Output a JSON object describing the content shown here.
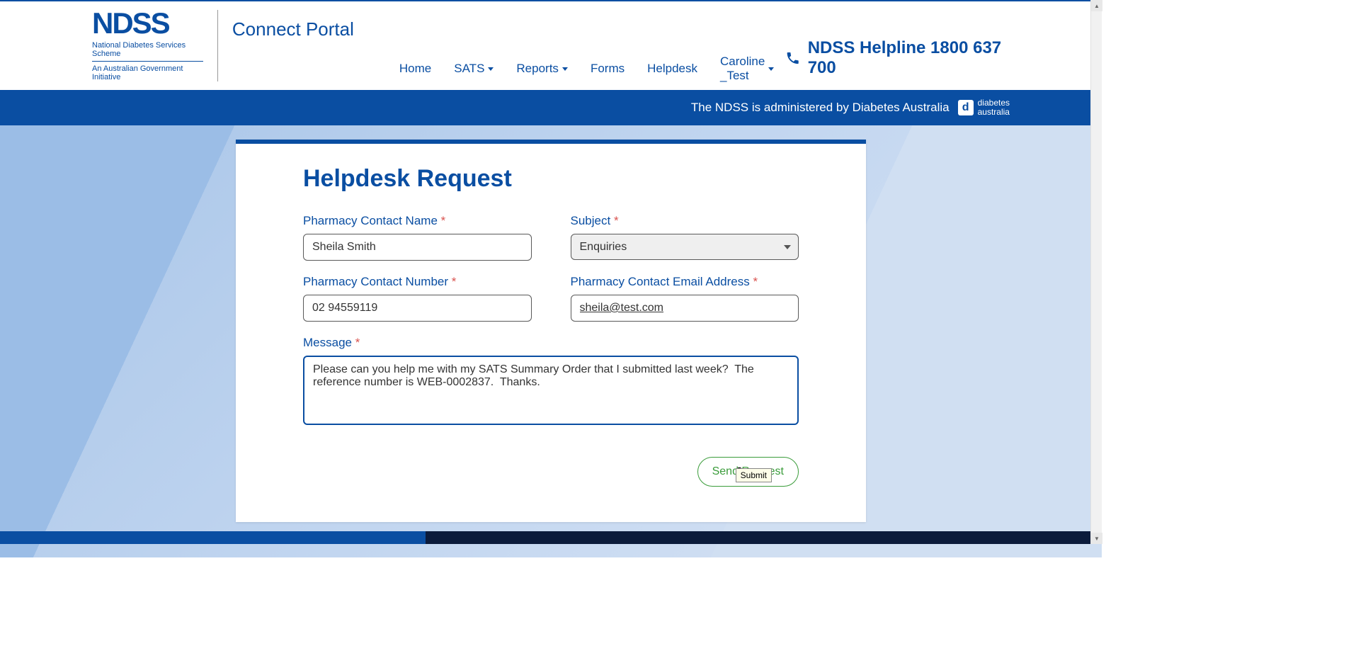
{
  "logo": {
    "main": "NDSS",
    "sub1": "National Diabetes Services Scheme",
    "sub2": "An Australian Government Initiative"
  },
  "portal_title": "Connect Portal",
  "nav": {
    "home": "Home",
    "sats": "SATS",
    "reports": "Reports",
    "forms": "Forms",
    "helpdesk": "Helpdesk",
    "user": "Caroline _Test"
  },
  "helpline": "NDSS Helpline 1800 637 700",
  "admin_text": "The NDSS is administered by Diabetes Australia",
  "da_brand": {
    "line1": "diabetes",
    "line2": "australia"
  },
  "form": {
    "title": "Helpdesk Request",
    "labels": {
      "name": "Pharmacy Contact Name",
      "subject": "Subject",
      "number": "Pharmacy Contact Number",
      "email": "Pharmacy Contact Email Address",
      "message": "Message"
    },
    "values": {
      "name": "Sheila Smith",
      "subject": "Enquiries",
      "number": "02 94559119",
      "email": "sheila@test.com",
      "message": "Please can you help me with my SATS Summary Order that I submitted last week?  The reference number is WEB-0002837.  Thanks."
    },
    "send_label": "Send Request",
    "tooltip": "Submit"
  }
}
